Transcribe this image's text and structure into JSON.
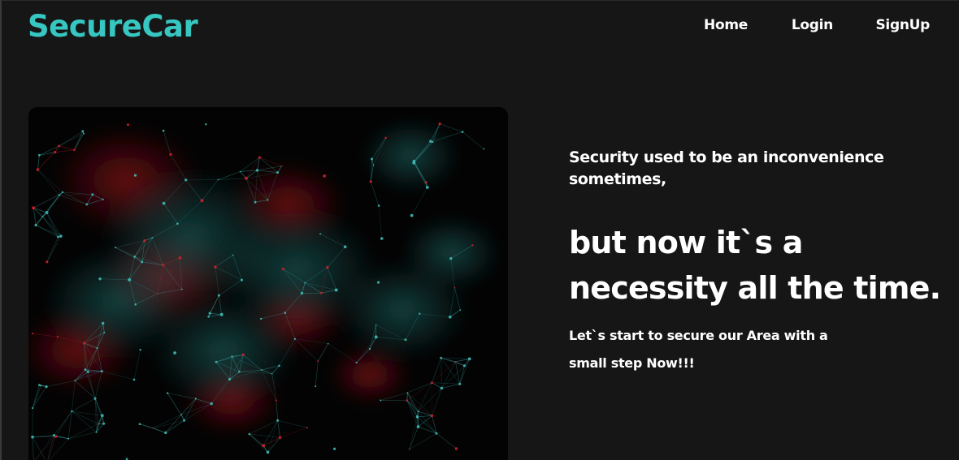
{
  "brand": {
    "name": "SecureCar",
    "color": "#37c7c2"
  },
  "nav": {
    "items": [
      {
        "label": "Home"
      },
      {
        "label": "Login"
      },
      {
        "label": "SignUp"
      }
    ]
  },
  "hero": {
    "image_icon": "network-particles-image",
    "tagline": "Security used to be an inconvenience sometimes,",
    "headline": "but now it`s a necessity all the time.",
    "subtext": "Let`s start to secure our Area with a small step Now!!!"
  },
  "colors": {
    "background": "#161616",
    "text": "#ffffff",
    "network_teal": "#3fb8b4",
    "network_red": "#c8202a"
  }
}
